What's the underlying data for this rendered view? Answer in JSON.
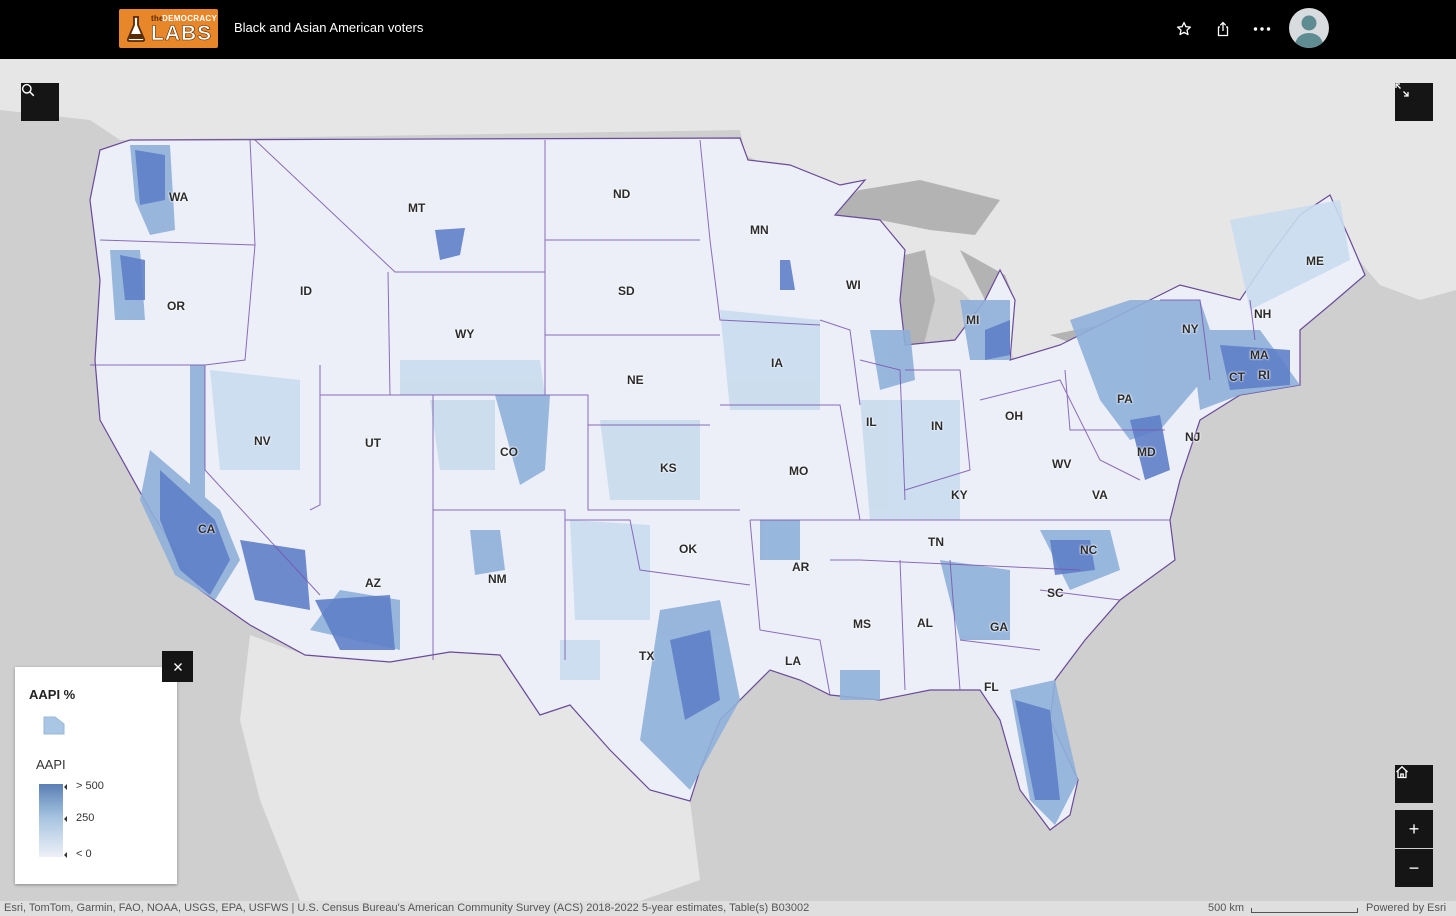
{
  "header": {
    "logo_small_the": "the",
    "logo_small_democracy": "DEMOCRACY",
    "logo_labs": "LABS",
    "title": "Black and Asian American voters",
    "favorite_icon": "star-icon",
    "share_icon": "share-icon",
    "more_icon": "more-horizontal-icon",
    "avatar_icon": "user-avatar-icon"
  },
  "map": {
    "search_icon": "search-icon",
    "fullscreen_icon": "expand-icon",
    "home_icon": "home-icon",
    "zoom_in_label": "+",
    "zoom_out_label": "−",
    "state_labels": [
      "WA",
      "OR",
      "CA",
      "NV",
      "ID",
      "MT",
      "WY",
      "UT",
      "AZ",
      "CO",
      "NM",
      "ND",
      "SD",
      "NE",
      "KS",
      "OK",
      "TX",
      "MN",
      "IA",
      "MO",
      "AR",
      "LA",
      "WI",
      "IL",
      "MS",
      "MI",
      "IN",
      "KY",
      "TN",
      "AL",
      "OH",
      "GA",
      "FL",
      "SC",
      "NC",
      "WV",
      "VA",
      "PA",
      "NY",
      "MD",
      "NJ",
      "CT",
      "RI",
      "MA",
      "NH",
      "ME"
    ]
  },
  "legend": {
    "close_label": "×",
    "layer_title": "AAPI %",
    "field_title": "AAPI",
    "ramp_labels": [
      "> 500",
      "250",
      "< 0"
    ]
  },
  "attribution": {
    "text": "Esri, TomTom, Garmin, FAO, NOAA, USGS, EPA, USFWS | U.S. Census Bureau's American Community Survey (ACS) 2018-2022 5-year estimates, Table(s) B03002",
    "scale": "500 km",
    "powered_by": "Powered by Esri"
  },
  "colors": {
    "header_bg": "#000000",
    "logo_bg": "#e8862a",
    "land_bg": "#e6e6e6",
    "water_bg": "#cfcfcf",
    "us_fill": "#eceff8",
    "low": "#c9dcee",
    "mid": "#8fb0d9",
    "high": "#5f80c8",
    "county_line": "#9b6fd6"
  }
}
